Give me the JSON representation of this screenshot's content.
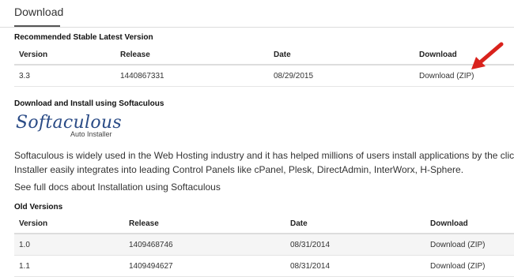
{
  "tabs": {
    "active_label": "Download"
  },
  "recommended": {
    "title": "Recommended Stable Latest Version",
    "columns": [
      "Version",
      "Release",
      "Date",
      "Download"
    ],
    "rows": [
      {
        "version": "3.3",
        "release": "1440867331",
        "date": "08/29/2015",
        "download": "Download (ZIP)"
      }
    ]
  },
  "softaculous": {
    "title": "Download and Install using Softaculous",
    "logo_text": "Softaculous",
    "logo_sub": "Auto Installer",
    "description_line1": "Softaculous is widely used in the Web Hosting industry and it has helped millions of users install applications by the clic",
    "description_line2": "Installer easily integrates into leading Control Panels like cPanel, Plesk, DirectAdmin, InterWorx, H-Sphere.",
    "docs_link": "See full docs about Installation using Softaculous"
  },
  "old_versions": {
    "title": "Old Versions",
    "columns": [
      "Version",
      "Release",
      "Date",
      "Download"
    ],
    "rows": [
      {
        "version": "1.0",
        "release": "1409468746",
        "date": "08/31/2014",
        "download": "Download (ZIP)"
      },
      {
        "version": "1.1",
        "release": "1409494627",
        "date": "08/31/2014",
        "download": "Download (ZIP)"
      }
    ]
  },
  "colors": {
    "arrow": "#d9221c",
    "logo": "#2a4b86"
  }
}
